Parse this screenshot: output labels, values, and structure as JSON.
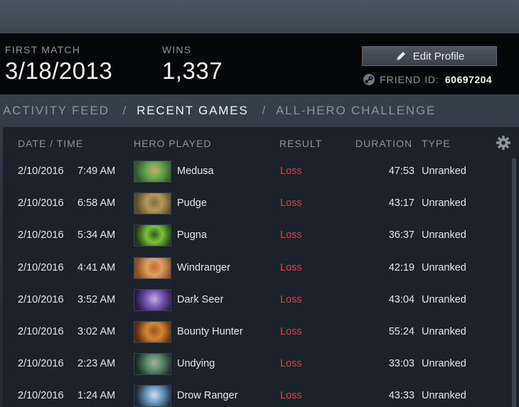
{
  "stats": {
    "first_match_label": "FIRST MATCH",
    "first_match_value": "3/18/2013",
    "wins_label": "WINS",
    "wins_value": "1,337"
  },
  "profile": {
    "edit_label": "Edit Profile",
    "friend_id_label": "FRIEND ID:",
    "friend_id_value": "60697204"
  },
  "tabs": [
    {
      "label": "ACTIVITY FEED",
      "active": false
    },
    {
      "label": "RECENT GAMES",
      "active": true
    },
    {
      "label": "ALL-HERO CHALLENGE",
      "active": false
    }
  ],
  "tab_separator": "/",
  "table": {
    "headers": {
      "date_time": "DATE / TIME",
      "hero": "HERO PLAYED",
      "result": "RESULT",
      "duration": "DURATION",
      "type": "TYPE"
    },
    "rows": [
      {
        "date": "2/10/2016",
        "time": "7:49 AM",
        "hero": "Medusa",
        "result": "Loss",
        "duration": "47:53",
        "type": "Unranked",
        "portrait_colors": [
          "#2f5a2a",
          "#6aa84f",
          "#c9a86a"
        ]
      },
      {
        "date": "2/10/2016",
        "time": "6:58 AM",
        "hero": "Pudge",
        "result": "Loss",
        "duration": "43:17",
        "type": "Unranked",
        "portrait_colors": [
          "#5a4a2a",
          "#b59a5a",
          "#8a6a3a"
        ]
      },
      {
        "date": "2/10/2016",
        "time": "5:34 AM",
        "hero": "Pugna",
        "result": "Loss",
        "duration": "36:37",
        "type": "Unranked",
        "portrait_colors": [
          "#1f3a12",
          "#7bc23a",
          "#2e5a1a"
        ]
      },
      {
        "date": "2/10/2016",
        "time": "4:41 AM",
        "hero": "Windranger",
        "result": "Loss",
        "duration": "42:19",
        "type": "Unranked",
        "portrait_colors": [
          "#8a4a1a",
          "#e0a060",
          "#c06a30"
        ]
      },
      {
        "date": "2/10/2016",
        "time": "3:52 AM",
        "hero": "Dark Seer",
        "result": "Loss",
        "duration": "43:04",
        "type": "Unranked",
        "portrait_colors": [
          "#2a1a4a",
          "#7a5ab5",
          "#c0b0e0"
        ]
      },
      {
        "date": "2/10/2016",
        "time": "3:02 AM",
        "hero": "Bounty Hunter",
        "result": "Loss",
        "duration": "55:24",
        "type": "Unranked",
        "portrait_colors": [
          "#5a2a10",
          "#d08a30",
          "#a05020"
        ]
      },
      {
        "date": "2/10/2016",
        "time": "2:23 AM",
        "hero": "Undying",
        "result": "Loss",
        "duration": "33:03",
        "type": "Unranked",
        "portrait_colors": [
          "#1a2a22",
          "#5a8a6a",
          "#a0b0a0"
        ]
      },
      {
        "date": "2/10/2016",
        "time": "1:24 AM",
        "hero": "Drow Ranger",
        "result": "Loss",
        "duration": "43:33",
        "type": "Unranked",
        "portrait_colors": [
          "#1a2a3a",
          "#6a9ac0",
          "#d0e0f0"
        ]
      }
    ]
  },
  "icons": {
    "edit": "pencil-icon",
    "friend": "steam-icon",
    "settings": "gear-icon"
  },
  "colors": {
    "loss": "#e24040",
    "active_tab": "#f4f6f7",
    "inactive_tab": "#8b959e"
  }
}
